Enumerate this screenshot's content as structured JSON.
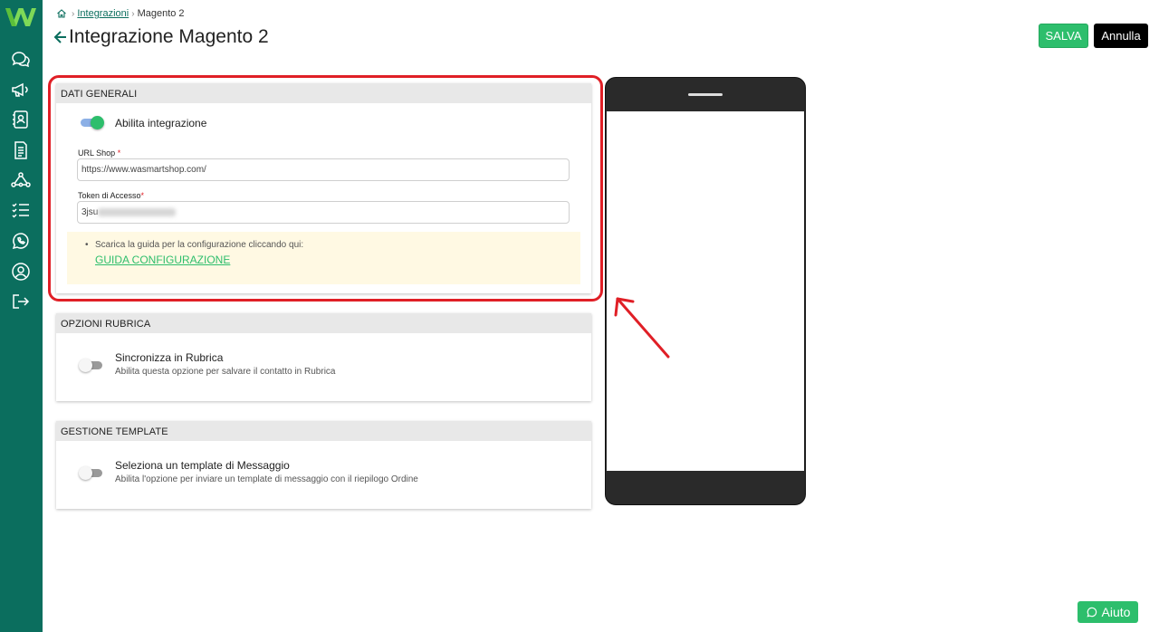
{
  "breadcrumb": {
    "link": "Integrazioni",
    "current": "Magento 2"
  },
  "page": {
    "title": "Integrazione Magento 2"
  },
  "actions": {
    "save_label": "SALVA",
    "cancel_label": "Annulla",
    "help_label": "Aiuto"
  },
  "dati_generali": {
    "header": "DATI GENERALI",
    "toggle_label": "Abilita integrazione",
    "toggle_on": true,
    "url_label": "URL Shop",
    "url_required": "*",
    "url_value": "https://www.wasmartshop.com/",
    "token_label": "Token di Accesso",
    "token_required": "*",
    "token_value_visible": "3jsu",
    "info_text": "Scarica la guida per la configurazione cliccando qui:",
    "info_bullet": "•",
    "guide_link": "GUIDA CONFIGURAZIONE"
  },
  "opzioni_rubrica": {
    "header": "OPZIONI RUBRICA",
    "toggle_label": "Sincronizza in Rubrica",
    "toggle_desc": "Abilita questa opzione per salvare il contatto in Rubrica",
    "toggle_on": false
  },
  "gestione_template": {
    "header": "GESTIONE TEMPLATE",
    "toggle_label": "Seleziona un template di Messaggio",
    "toggle_desc": "Abilita l'opzione per inviare un template di messaggio con il riepilogo Ordine",
    "toggle_on": false
  },
  "sidebar": {
    "icons": [
      "chat-icon",
      "megaphone-icon",
      "contacts-icon",
      "document-icon",
      "flow-icon",
      "checklist-icon",
      "whatsapp-icon",
      "user-circle-icon",
      "logout-icon"
    ]
  },
  "colors": {
    "sidebar": "#0b6e5e",
    "accent_green": "#2dbe6c",
    "highlight_red": "#e01f26",
    "info_bg": "#fff9e3"
  }
}
